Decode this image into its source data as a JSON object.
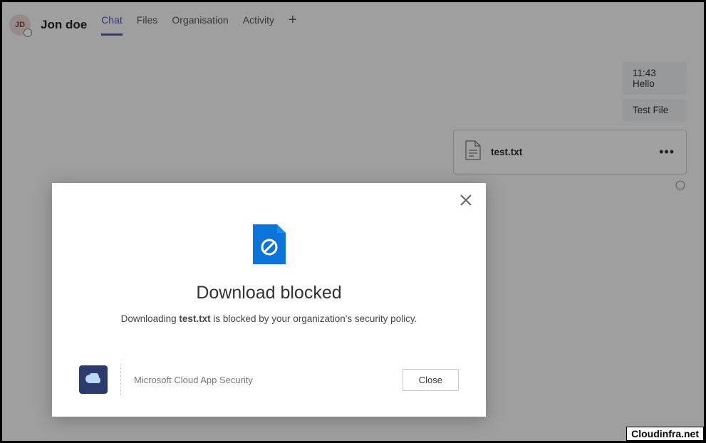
{
  "contact": {
    "initials": "JD",
    "name": "Jon doe"
  },
  "tabs": {
    "chat": "Chat",
    "files": "Files",
    "organisation": "Organisation",
    "activity": "Activity"
  },
  "messages": {
    "time": "11:43",
    "hello": "Hello",
    "testfile": "Test File"
  },
  "file": {
    "name": "test.txt"
  },
  "modal": {
    "title": "Download blocked",
    "desc_prefix": "Downloading ",
    "desc_file": "test.txt",
    "desc_suffix": " is blocked by your organization's security policy.",
    "footer_text": "Microsoft Cloud App Security",
    "close_label": "Close"
  },
  "watermark": "Cloudinfra.net"
}
